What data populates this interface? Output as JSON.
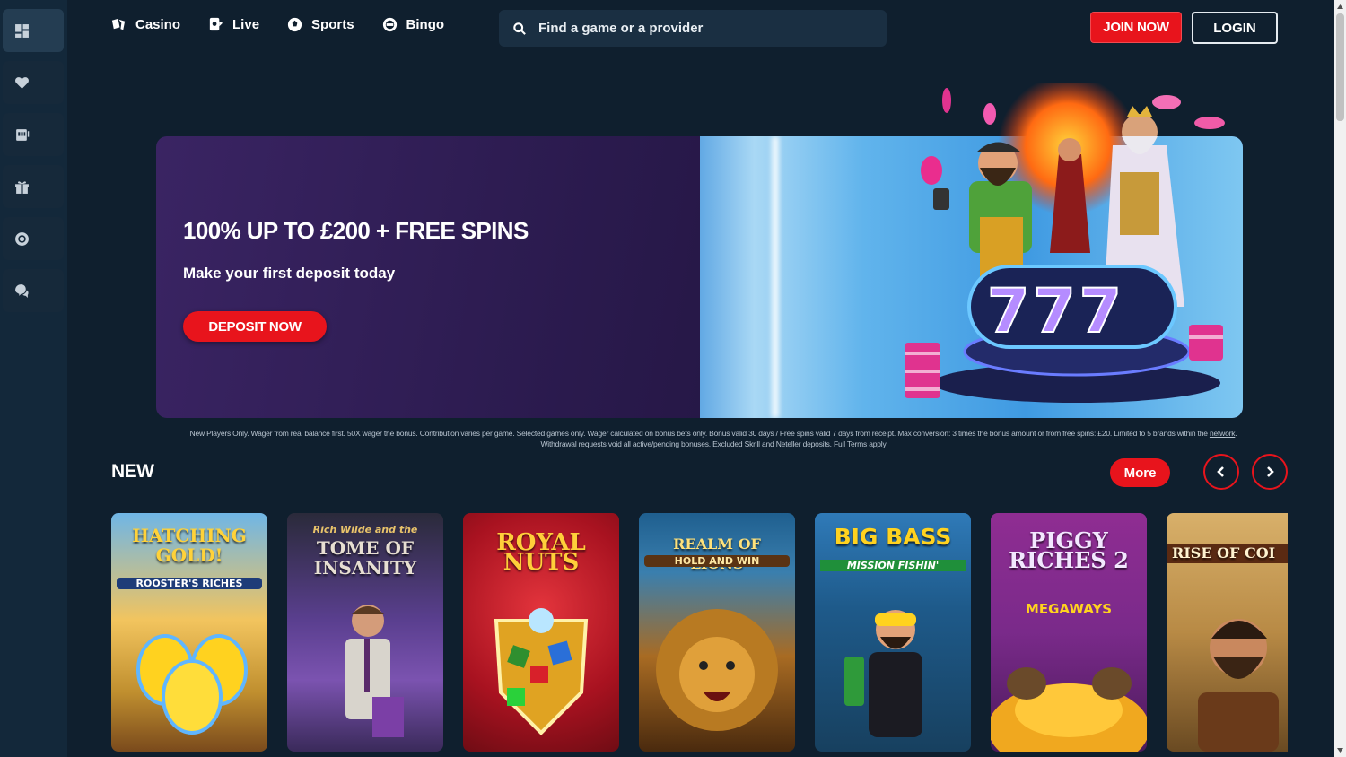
{
  "nav": {
    "items": [
      {
        "label": "Casino",
        "icon": "cards-icon"
      },
      {
        "label": "Live",
        "icon": "live-dealer-icon"
      },
      {
        "label": "Sports",
        "icon": "football-icon"
      },
      {
        "label": "Bingo",
        "icon": "bingo-icon"
      }
    ]
  },
  "search": {
    "placeholder": "Find a game or a provider"
  },
  "header": {
    "join_label": "JOIN NOW",
    "login_label": "LOGIN"
  },
  "sidebar": {
    "icons": [
      "dashboard-icon",
      "heart-icon",
      "slot-machine-icon",
      "gift-icon",
      "chip-icon",
      "chat-support-icon"
    ]
  },
  "banner": {
    "title": "100% UP TO £200 + FREE SPINS",
    "subtitle": "Make your first deposit today",
    "cta": "DEPOSIT NOW",
    "slot_reels": "777"
  },
  "terms": {
    "text": "New Players Only. Wager from real balance first. 50X wager the bonus. Contribution varies per game. Selected games only. Wager calculated on bonus bets only. Bonus valid 30 days / Free spins valid 7 days from receipt. Max conversion: 3 times the bonus amount or from free spins: £20. Limited to 5 brands within the ",
    "link1": "network",
    "text2": ". Withdrawal requests void all active/pending bonuses. Excluded Skrill and Neteller deposits. ",
    "link2": "Full Terms apply"
  },
  "section": {
    "title": "NEW",
    "more_label": "More"
  },
  "games": [
    {
      "name": "HATCHING GOLD!",
      "sub": "ROOSTER'S RICHES",
      "bg": "#c9913a"
    },
    {
      "name": "TOME OF INSANITY",
      "sub": "Rich Wilde and the",
      "bg": "#4a3a78"
    },
    {
      "name": "ROYAL NUTS",
      "sub": "",
      "bg": "#b4161f"
    },
    {
      "name": "REALM OF LIONS",
      "sub": "HOLD AND WIN",
      "bg": "#8a5a1e"
    },
    {
      "name": "BIG BASS",
      "sub": "MISSION FISHIN'",
      "bg": "#1a4e7a"
    },
    {
      "name": "PIGGY RICHES 2",
      "sub": "MEGAWAYS",
      "bg": "#8a2f8f"
    },
    {
      "name": "RISE OF COI",
      "sub": "",
      "bg": "#a1712f"
    }
  ],
  "colors": {
    "accent": "#e8141c",
    "background": "#0f1f2e",
    "sidebar": "#13283a"
  }
}
